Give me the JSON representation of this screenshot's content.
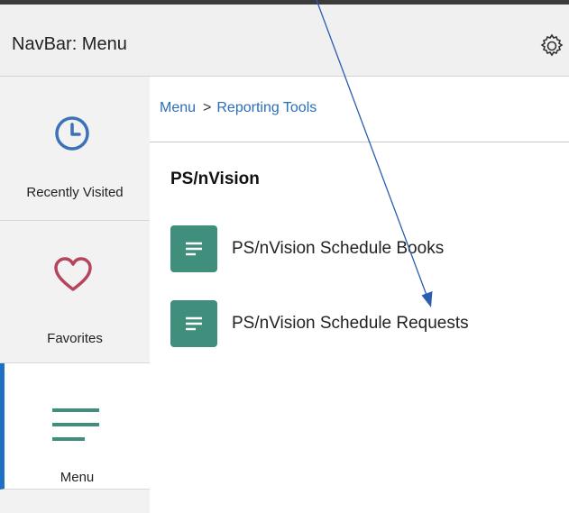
{
  "header": {
    "title": "NavBar: Menu",
    "settings_icon": "gear-icon"
  },
  "sidebar": {
    "items": [
      {
        "label": "Recently Visited",
        "icon": "clock-icon",
        "icon_color": "#3c72b8"
      },
      {
        "label": "Favorites",
        "icon": "heart-icon",
        "icon_color": "#b5445c"
      },
      {
        "label": "Menu",
        "icon": "hamburger-icon",
        "icon_color": "#3f8f7c",
        "active": true
      }
    ],
    "active_accent": "#1f6fc5"
  },
  "breadcrumb": {
    "root": "Menu",
    "separator": ">",
    "current": "Reporting Tools"
  },
  "section": {
    "title": "PS/nVision",
    "links": [
      {
        "label": "PS/nVision Schedule Books",
        "icon": "document-lines-icon"
      },
      {
        "label": "PS/nVision Schedule Requests",
        "icon": "document-lines-icon"
      }
    ]
  },
  "colors": {
    "link": "#2a6ebb",
    "tile": "#3f8f7c",
    "header_bg": "#f0f0f0",
    "annotation_arrow": "#2a5db0"
  }
}
